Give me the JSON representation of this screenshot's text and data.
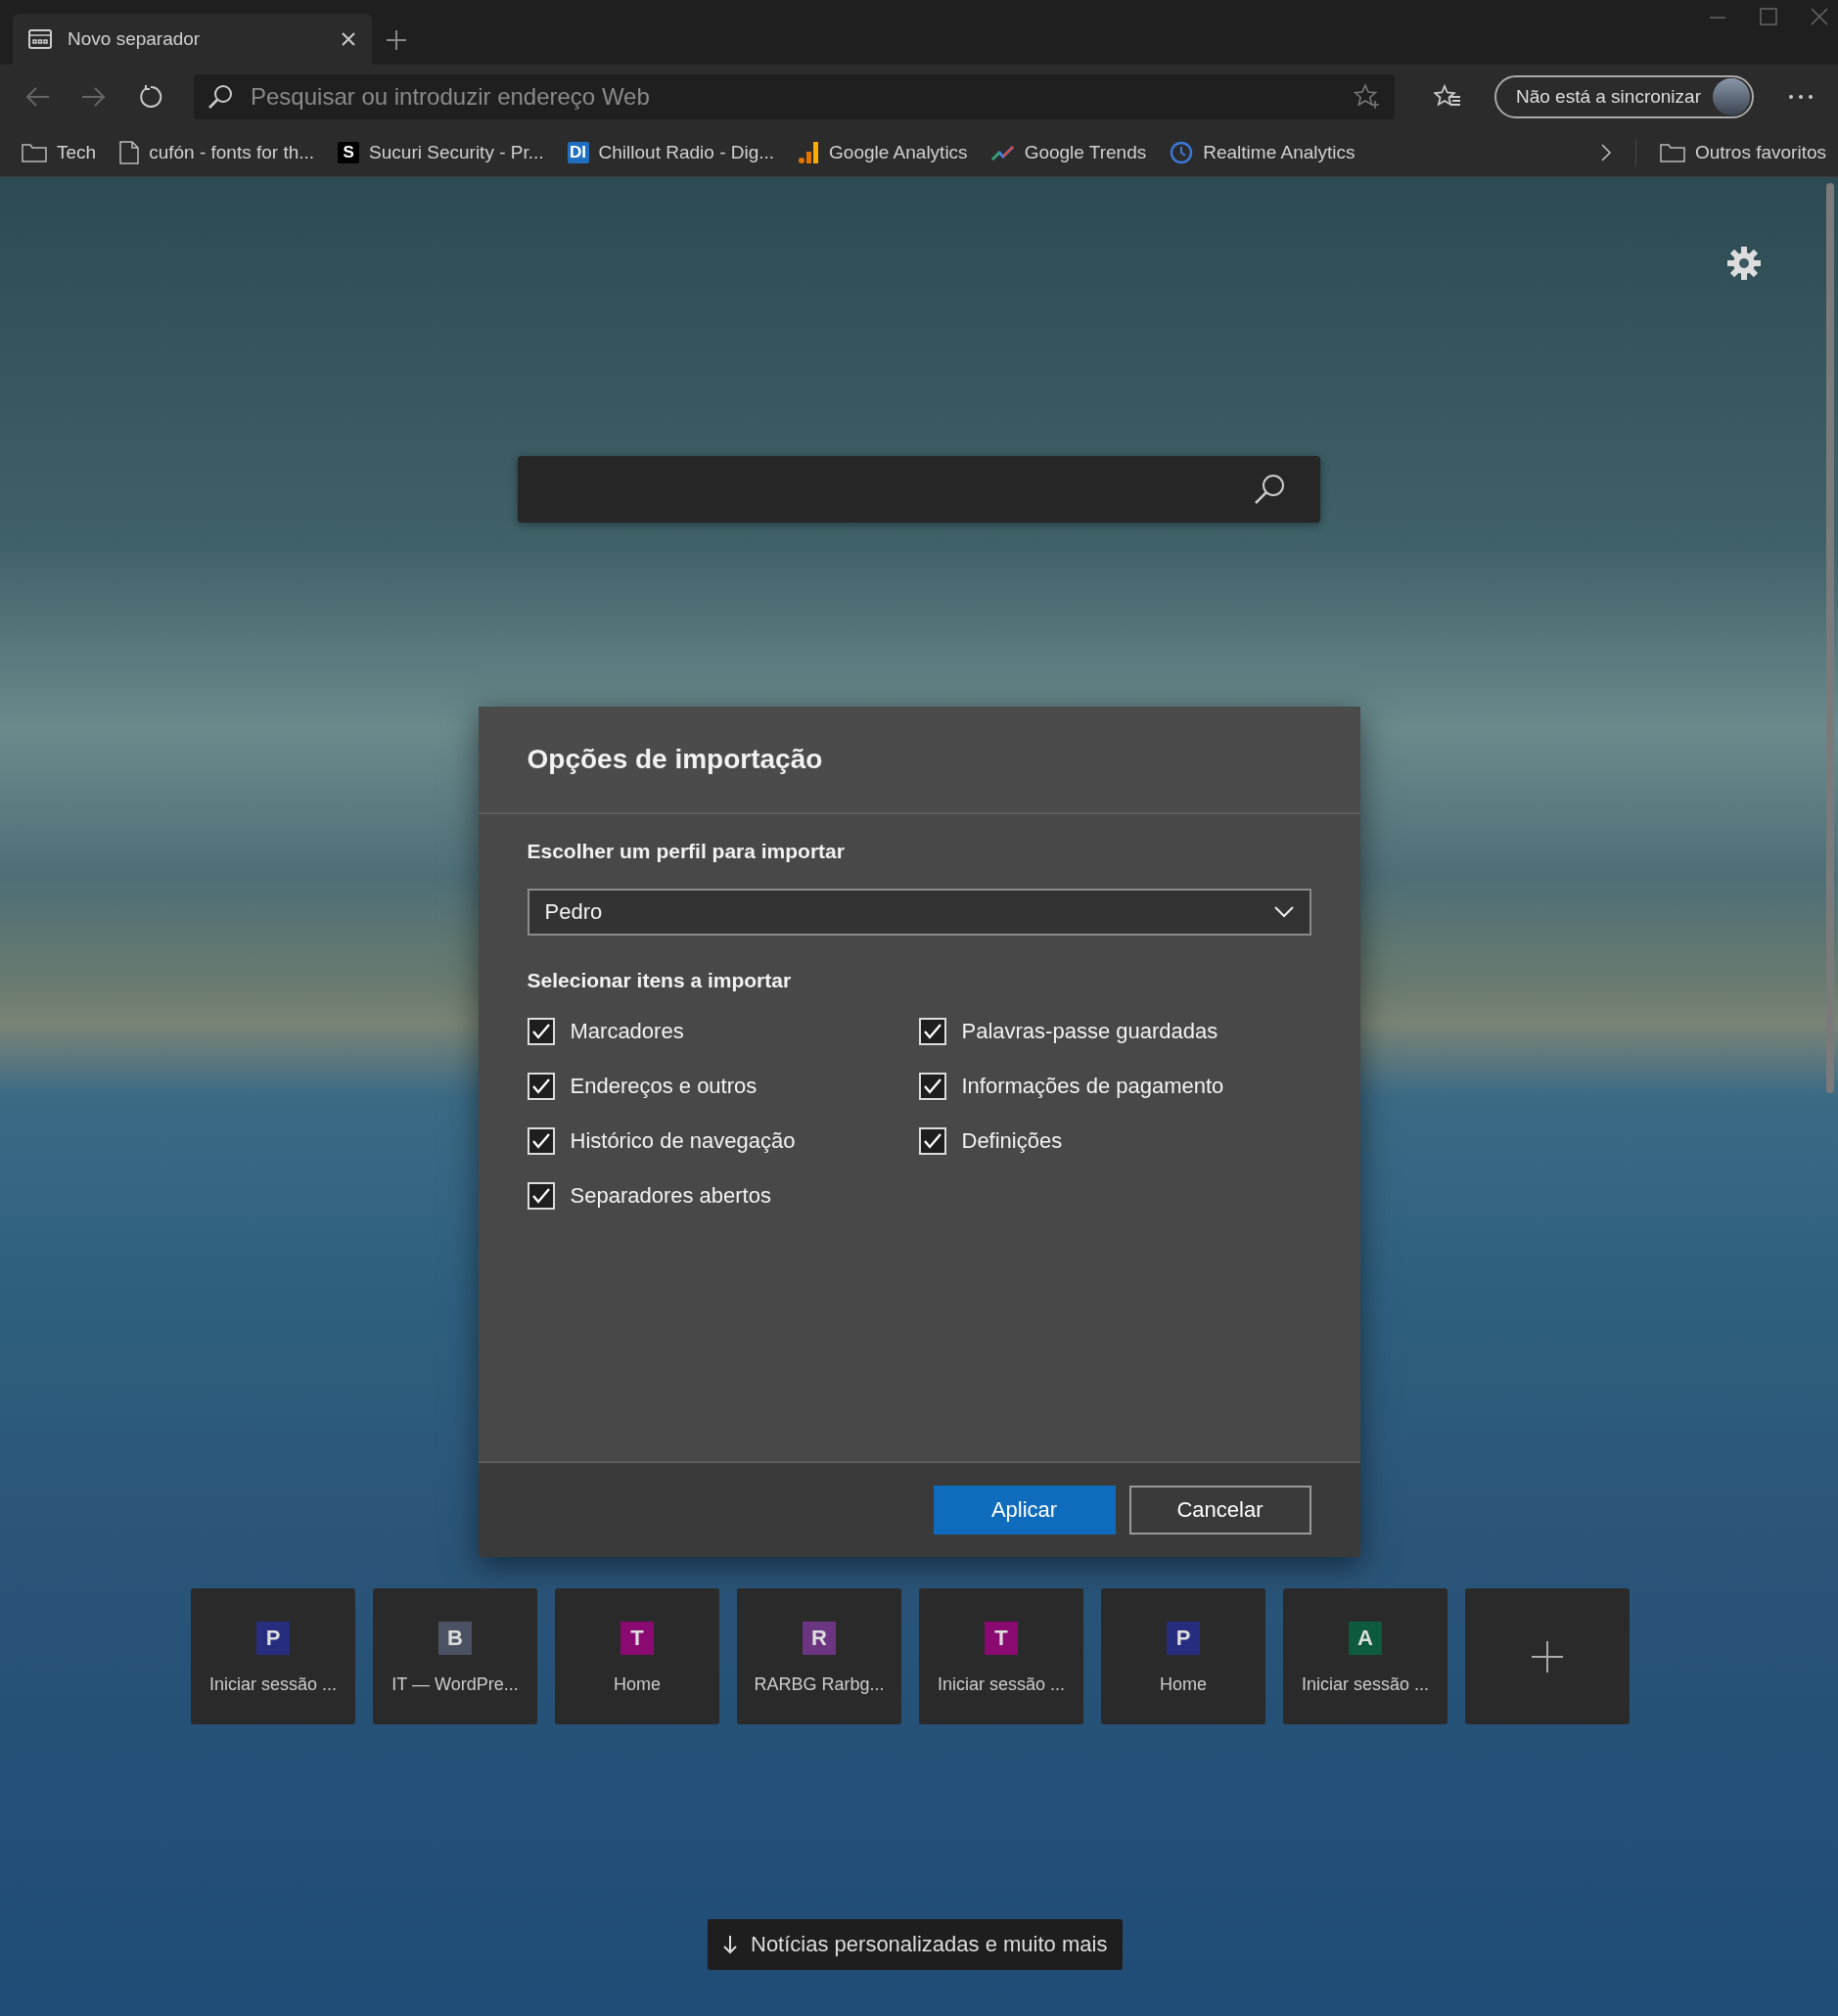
{
  "tab": {
    "title": "Novo separador"
  },
  "address_bar": {
    "placeholder": "Pesquisar ou introduzir endereço Web"
  },
  "sync_button": {
    "label": "Não está a sincronizar"
  },
  "bookmarks": [
    {
      "kind": "folder",
      "label": "Tech"
    },
    {
      "kind": "page",
      "label": "cufón - fonts for th..."
    },
    {
      "kind": "badge",
      "icon_text": "S",
      "color": "#000000",
      "label": "Sucuri Security - Pr..."
    },
    {
      "kind": "badge",
      "icon_text": "DI",
      "color": "#1f6fc0",
      "label": "Chillout Radio - Dig..."
    },
    {
      "kind": "bars",
      "label": "Google Analytics"
    },
    {
      "kind": "trend",
      "label": "Google Trends"
    },
    {
      "kind": "clock",
      "label": "Realtime Analytics"
    }
  ],
  "other_favorites": {
    "label": "Outros favoritos"
  },
  "dialog": {
    "title": "Opções de importação",
    "profile_label": "Escolher um perfil para importar",
    "profile": "Pedro",
    "items_label": "Selecionar itens a importar",
    "items": [
      {
        "label": "Marcadores",
        "checked": true
      },
      {
        "label": "Palavras-passe guardadas",
        "checked": true
      },
      {
        "label": "Endereços e outros",
        "checked": true
      },
      {
        "label": "Informações de pagamento",
        "checked": true
      },
      {
        "label": "Histórico de navegação",
        "checked": true
      },
      {
        "label": "Definições",
        "checked": true
      },
      {
        "label": "Separadores abertos",
        "checked": true
      }
    ],
    "buttons": [
      {
        "label": "Aplicar",
        "primary": true
      },
      {
        "label": "Cancelar",
        "primary": false
      }
    ]
  },
  "tiles": [
    {
      "letter": "P",
      "color": "#262c7e",
      "label": "Iniciar sessão ..."
    },
    {
      "letter": "B",
      "color": "#4a5263",
      "label": "IT — WordPre..."
    },
    {
      "letter": "T",
      "color": "#8b0a72",
      "label": "Home"
    },
    {
      "letter": "R",
      "color": "#6c3582",
      "label": "RARBG Rarbg..."
    },
    {
      "letter": "T",
      "color": "#8b0a72",
      "label": "Iniciar sessão ..."
    },
    {
      "letter": "P",
      "color": "#262c7e",
      "label": "Home"
    },
    {
      "letter": "A",
      "color": "#0d5b3c",
      "label": "Iniciar sessão ..."
    }
  ],
  "news_button": {
    "label": "Notícias personalizadas e muito mais"
  }
}
